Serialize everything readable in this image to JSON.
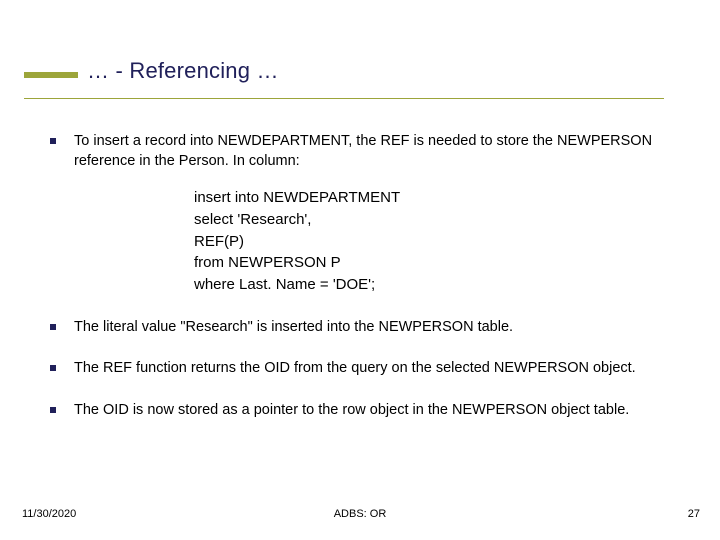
{
  "title": "… - Referencing …",
  "bullets": [
    "To insert a record into NEWDEPARTMENT, the REF is needed to store the NEWPERSON reference in the Person. In column:",
    "The literal value \"Research\" is inserted into the NEWPERSON table.",
    "The REF function returns the OID from the query on the selected NEWPERSON object.",
    "The OID is now stored as a pointer to the row object in the NEWPERSON object table."
  ],
  "code": [
    "insert into NEWDEPARTMENT",
    "select 'Research',",
    "REF(P)",
    "from NEWPERSON P",
    "where Last. Name = 'DOE';"
  ],
  "footer": {
    "date": "11/30/2020",
    "center": "ADBS: OR",
    "page": "27"
  }
}
